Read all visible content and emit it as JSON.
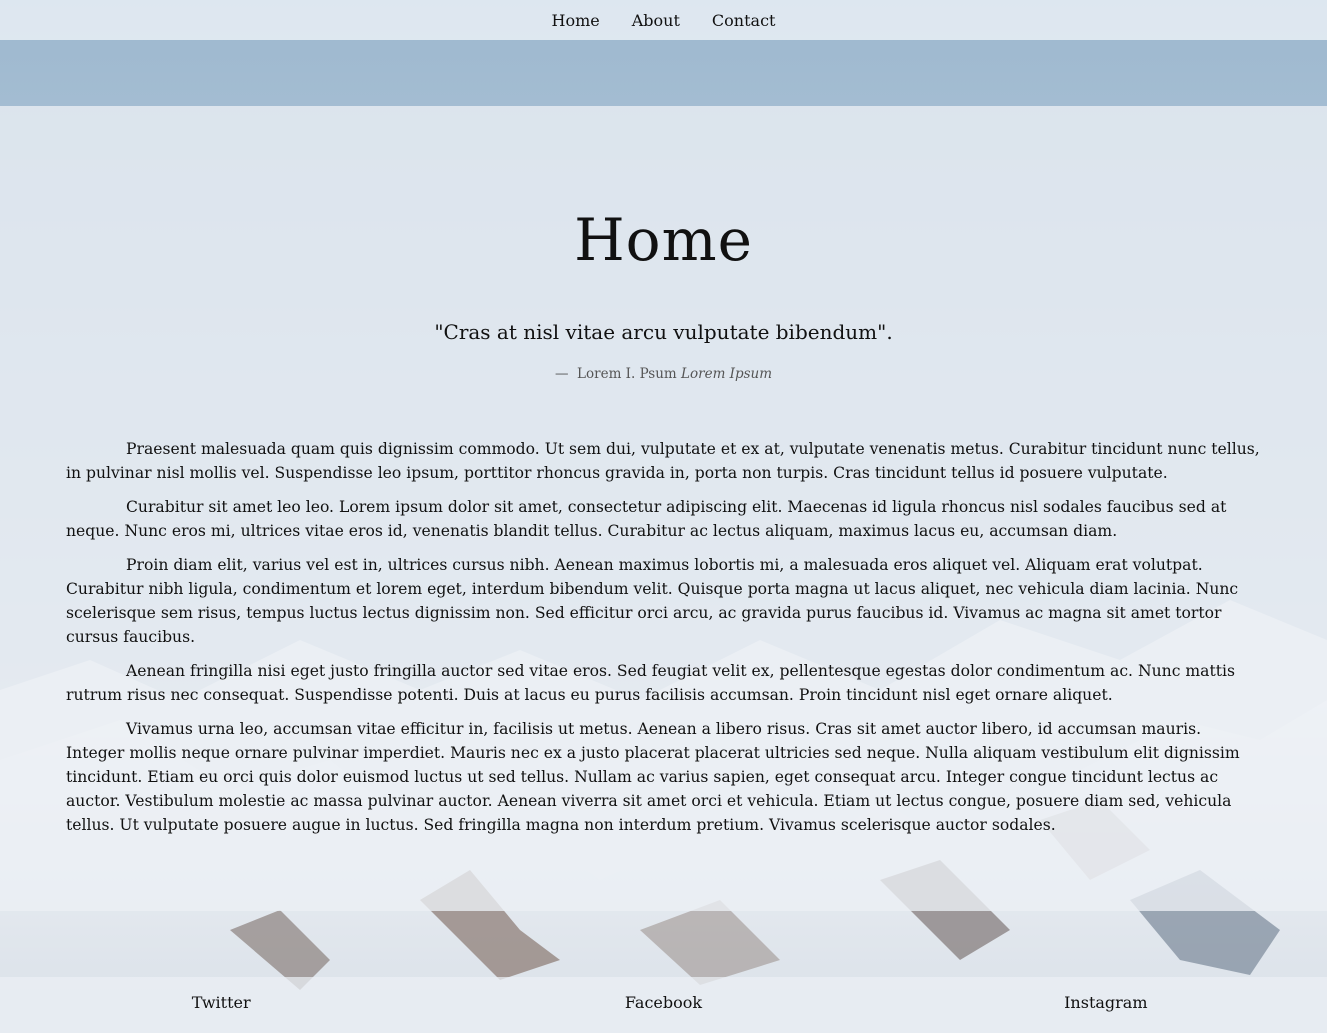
{
  "nav": {
    "items": [
      {
        "label": "Home"
      },
      {
        "label": "About"
      },
      {
        "label": "Contact"
      }
    ]
  },
  "main": {
    "title": "Home",
    "quote": "\"Cras at nisl vitae arcu vulputate bibendum\".",
    "attribution": {
      "dash": "—",
      "author": "Lorem I. Psum",
      "source": "Lorem Ipsum"
    },
    "paragraphs": [
      "Praesent malesuada quam quis dignissim commodo. Ut sem dui, vulputate et ex at, vulputate venenatis metus. Curabitur tincidunt nunc tellus, in pulvinar nisl mollis vel. Suspendisse leo ipsum, porttitor rhoncus gravida in, porta non turpis. Cras tincidunt tellus id posuere vulputate.",
      "Curabitur sit amet leo leo. Lorem ipsum dolor sit amet, consectetur adipiscing elit. Maecenas id ligula rhoncus nisl sodales faucibus sed at neque. Nunc eros mi, ultrices vitae eros id, venenatis blandit tellus. Curabitur ac lectus aliquam, maximus lacus eu, accumsan diam.",
      "Proin diam elit, varius vel est in, ultrices cursus nibh. Aenean maximus lobortis mi, a malesuada eros aliquet vel. Aliquam erat volutpat. Curabitur nibh ligula, condimentum et lorem eget, interdum bibendum velit. Quisque porta magna ut lacus aliquet, nec vehicula diam lacinia. Nunc scelerisque sem risus, tempus luctus lectus dignissim non. Sed efficitur orci arcu, ac gravida purus faucibus id. Vivamus ac magna sit amet tortor cursus faucibus.",
      "Aenean fringilla nisi eget justo fringilla auctor sed vitae eros. Sed feugiat velit ex, pellentesque egestas dolor condimentum ac. Nunc mattis rutrum risus nec consequat. Suspendisse potenti. Duis at lacus eu purus facilisis accumsan. Proin tincidunt nisl eget ornare aliquet.",
      "Vivamus urna leo, accumsan vitae efficitur in, facilisis ut metus. Aenean a libero risus. Cras sit amet auctor libero, id accumsan mauris. Integer mollis neque ornare pulvinar imperdiet. Mauris nec ex a justo placerat placerat ultricies sed neque. Nulla aliquam vestibulum elit dignissim tincidunt. Etiam eu orci quis dolor euismod luctus ut sed tellus. Nullam ac varius sapien, eget consequat arcu. Integer congue tincidunt lectus ac auctor. Vestibulum molestie ac massa pulvinar auctor. Aenean viverra sit amet orci et vehicula. Etiam ut lectus congue, posuere diam sed, vehicula tellus. Ut vulputate posuere augue in luctus. Sed fringilla magna non interdum pretium. Vivamus scelerisque auctor sodales."
    ]
  },
  "footer": {
    "links": [
      {
        "label": "Twitter"
      },
      {
        "label": "Facebook"
      },
      {
        "label": "Instagram"
      }
    ]
  }
}
